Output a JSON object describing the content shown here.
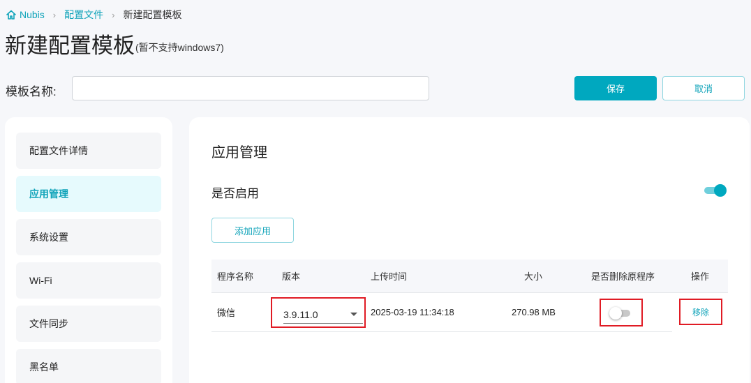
{
  "breadcrumb": {
    "home": "Nubis",
    "profiles": "配置文件",
    "current": "新建配置模板",
    "home_icon": "home-icon",
    "separator_icon": "chevron-right-icon"
  },
  "page": {
    "title": "新建配置模板",
    "note": "(暂不支持windows7)"
  },
  "form": {
    "name_label": "模板名称:",
    "name_value": "",
    "save_label": "保存",
    "cancel_label": "取消"
  },
  "sidebar": {
    "items": [
      {
        "label": "配置文件详情",
        "active": false
      },
      {
        "label": "应用管理",
        "active": true
      },
      {
        "label": "系统设置",
        "active": false
      },
      {
        "label": "Wi-Fi",
        "active": false
      },
      {
        "label": "文件同步",
        "active": false
      },
      {
        "label": "黑名单",
        "active": false
      }
    ]
  },
  "main": {
    "section_title": "应用管理",
    "enable_label": "是否启用",
    "enable_on": true,
    "add_app_label": "添加应用",
    "table": {
      "headers": [
        "程序名称",
        "版本",
        "上传时间",
        "大小",
        "是否删除原程序",
        "操作"
      ],
      "rows": [
        {
          "name": "微信",
          "version": "3.9.11.0",
          "upload_time": "2025-03-19 11:34:18",
          "size": "270.98 MB",
          "delete_original": false,
          "action": "移除"
        }
      ]
    }
  },
  "colors": {
    "accent": "#00a8bf",
    "highlight_border": "#e01b24",
    "background": "#f6f7fa"
  }
}
